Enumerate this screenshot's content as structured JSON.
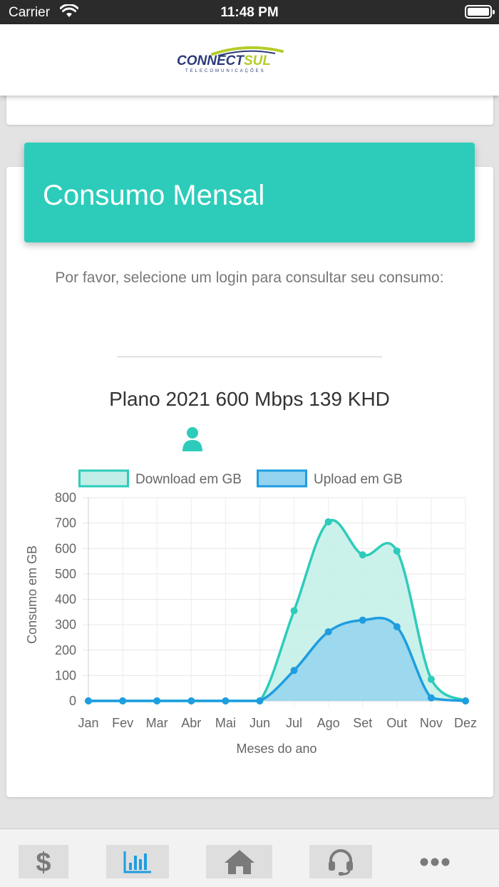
{
  "status_bar": {
    "carrier": "Carrier",
    "time": "11:48 PM"
  },
  "header": {
    "logo_main": "CONNECTSUL",
    "logo_word_a": "CONNECT",
    "logo_word_b": "SUL",
    "logo_sub": "TELECOMUNICAÇÕES"
  },
  "card": {
    "title": "Consumo Mensal",
    "instruction": "Por favor, selecione um login para consultar seu consumo:",
    "login_value": "",
    "plan_name": "Plano 2021 600 Mbps 139 KHD",
    "user_icon": "user-icon"
  },
  "chart_data": {
    "type": "area",
    "title": "",
    "xlabel": "Meses do ano",
    "ylabel": "Consumo em GB",
    "ylim": [
      0,
      800
    ],
    "yticks": [
      0,
      100,
      200,
      300,
      400,
      500,
      600,
      700,
      800
    ],
    "categories": [
      "Jan",
      "Fev",
      "Mar",
      "Abr",
      "Mai",
      "Jun",
      "Jul",
      "Ago",
      "Set",
      "Out",
      "Nov",
      "Dez"
    ],
    "series": [
      {
        "name": "Download em GB",
        "color": "#2dccba",
        "fill": "#c2eee8",
        "values": [
          0,
          0,
          0,
          0,
          0,
          0,
          355,
          705,
          575,
          590,
          85,
          0
        ]
      },
      {
        "name": "Upload em GB",
        "color": "#1e9de0",
        "fill": "#94d3ef",
        "values": [
          0,
          0,
          0,
          0,
          0,
          0,
          120,
          272,
          318,
          292,
          12,
          0
        ]
      }
    ],
    "legend_position": "top",
    "grid": true
  },
  "tabbar": {
    "tabs": [
      {
        "name": "tab-financeiro",
        "icon": "dollar-icon",
        "active": false
      },
      {
        "name": "tab-consumo",
        "icon": "bar-chart-icon",
        "active": true
      },
      {
        "name": "tab-inicio",
        "icon": "home-icon",
        "active": false
      },
      {
        "name": "tab-suporte",
        "icon": "headset-icon",
        "active": false
      },
      {
        "name": "tab-mais",
        "icon": "more-icon",
        "active": false
      }
    ]
  },
  "colors": {
    "accent": "#2dccba",
    "active_tab": "#1e9de0",
    "inactive_tab": "#7a7a7a"
  }
}
